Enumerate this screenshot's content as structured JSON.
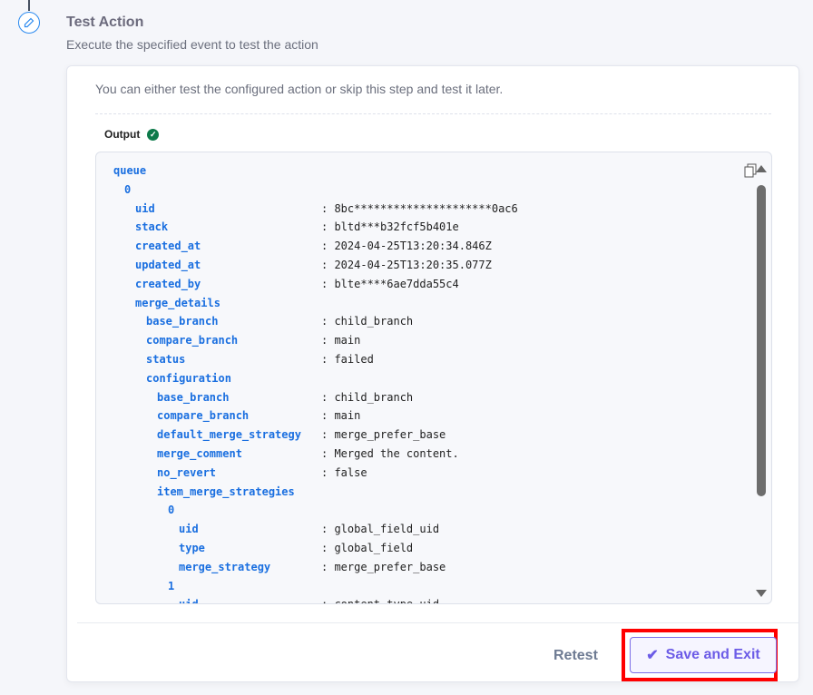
{
  "step": {
    "title": "Test Action",
    "subtitle": "Execute the specified event to test the action",
    "icon": "pencil-icon"
  },
  "card": {
    "description": "You can either test the configured action or skip this step and test it later.",
    "output_label": "Output"
  },
  "output_rows": [
    {
      "depth": 0,
      "key": "queue",
      "value": ""
    },
    {
      "depth": 1,
      "key": "0",
      "value": ""
    },
    {
      "depth": 2,
      "key": "uid",
      "value": ": 8bc*********************0ac6"
    },
    {
      "depth": 2,
      "key": "stack",
      "value": ": bltd***b32fcf5b401e"
    },
    {
      "depth": 2,
      "key": "created_at",
      "value": ": 2024-04-25T13:20:34.846Z"
    },
    {
      "depth": 2,
      "key": "updated_at",
      "value": ": 2024-04-25T13:20:35.077Z"
    },
    {
      "depth": 2,
      "key": "created_by",
      "value": ": blte****6ae7dda55c4"
    },
    {
      "depth": 2,
      "key": "merge_details",
      "value": ""
    },
    {
      "depth": 3,
      "key": "base_branch",
      "value": ": child_branch"
    },
    {
      "depth": 3,
      "key": "compare_branch",
      "value": ": main"
    },
    {
      "depth": 3,
      "key": "status",
      "value": ": failed"
    },
    {
      "depth": 3,
      "key": "configuration",
      "value": ""
    },
    {
      "depth": 4,
      "key": "base_branch",
      "value": ": child_branch"
    },
    {
      "depth": 4,
      "key": "compare_branch",
      "value": ": main"
    },
    {
      "depth": 4,
      "key": "default_merge_strategy",
      "value": ": merge_prefer_base"
    },
    {
      "depth": 4,
      "key": "merge_comment",
      "value": ": Merged the content."
    },
    {
      "depth": 4,
      "key": "no_revert",
      "value": ": false"
    },
    {
      "depth": 4,
      "key": "item_merge_strategies",
      "value": ""
    },
    {
      "depth": 5,
      "key": "0",
      "value": ""
    },
    {
      "depth": 6,
      "key": "uid",
      "value": ": global_field_uid"
    },
    {
      "depth": 6,
      "key": "type",
      "value": ": global_field"
    },
    {
      "depth": 6,
      "key": "merge_strategy",
      "value": ": merge_prefer_base"
    },
    {
      "depth": 5,
      "key": "1",
      "value": ""
    },
    {
      "depth": 6,
      "key": "uid",
      "value": ": content_type_uid"
    }
  ],
  "footer": {
    "retest_label": "Retest",
    "save_label": "Save and Exit"
  },
  "colors": {
    "accent": "#6c5ce7",
    "key": "#1a6fe0",
    "success": "#0d7a4a",
    "highlight": "#ff0000"
  }
}
